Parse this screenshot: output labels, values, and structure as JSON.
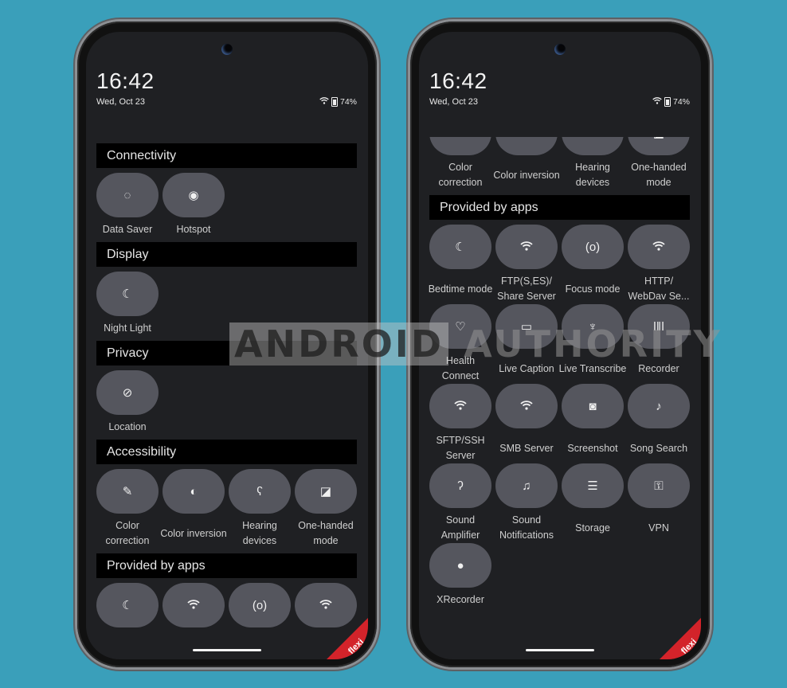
{
  "status": {
    "time": "16:42",
    "date": "Wed, Oct 23",
    "battery": "74%"
  },
  "sections": [
    {
      "title": "Connectivity",
      "tiles": [
        {
          "label": "Data Saver",
          "icon": "data-saver-icon"
        },
        {
          "label": "Hotspot",
          "icon": "hotspot-icon"
        }
      ]
    },
    {
      "title": "Display",
      "tiles": [
        {
          "label": "Night Light",
          "icon": "night-light-icon"
        }
      ]
    },
    {
      "title": "Privacy",
      "tiles": [
        {
          "label": "Location",
          "icon": "location-off-icon"
        }
      ]
    },
    {
      "title": "Accessibility",
      "tiles": [
        {
          "label": "Color correction",
          "icon": "eyedropper-icon"
        },
        {
          "label": "Color inversion",
          "icon": "contrast-icon"
        },
        {
          "label": "Hearing devices",
          "icon": "hearing-icon"
        },
        {
          "label": "One-handed mode",
          "icon": "one-handed-icon"
        }
      ]
    },
    {
      "title": "Provided by apps",
      "tiles": [
        {
          "label": "Bedtime mode",
          "icon": "bedtime-icon"
        },
        {
          "label": "FTP(S,ES)/ Share Server",
          "icon": "wifi-icon"
        },
        {
          "label": "Focus mode",
          "icon": "focus-icon"
        },
        {
          "label": "HTTP/ WebDav Se...",
          "icon": "wifi-icon"
        },
        {
          "label": "Health Connect",
          "icon": "health-icon"
        },
        {
          "label": "Live Caption",
          "icon": "caption-icon"
        },
        {
          "label": "Live Transcribe",
          "icon": "transcribe-icon"
        },
        {
          "label": "Recorder",
          "icon": "waveform-icon"
        },
        {
          "label": "SFTP/SSH Server",
          "icon": "wifi-icon"
        },
        {
          "label": "SMB Server",
          "icon": "wifi-icon"
        },
        {
          "label": "Screenshot",
          "icon": "camera-icon"
        },
        {
          "label": "Song Search",
          "icon": "music-note-icon"
        },
        {
          "label": "Sound Amplifier",
          "icon": "ear-icon"
        },
        {
          "label": "Sound Notifications",
          "icon": "bell-icon"
        },
        {
          "label": "Storage",
          "icon": "storage-icon"
        },
        {
          "label": "VPN",
          "icon": "vpn-icon"
        },
        {
          "label": "XRecorder",
          "icon": "record-dot-icon"
        }
      ]
    }
  ],
  "watermark": {
    "part1": "ANDROID",
    "part2": "AUTHORITY"
  },
  "badge": "flexi",
  "colors": {
    "background": "#3a9fba",
    "screen": "#1f2023",
    "tile": "#55565e",
    "header": "#000000",
    "badge": "#d3232a"
  }
}
